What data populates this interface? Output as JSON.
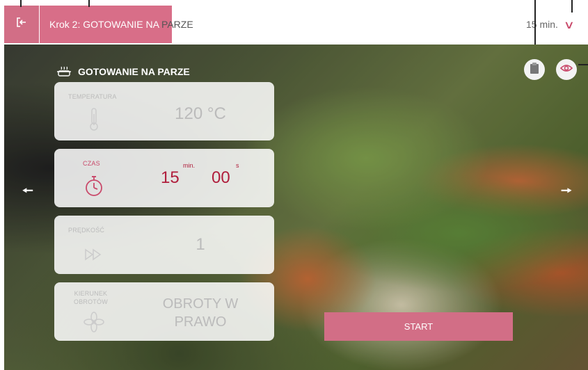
{
  "topbar": {
    "step_title_highlight": "Krok 2: GOTOWANIE NA",
    "step_title_rest": " PARZE",
    "duration_label": "15 min.",
    "exit_icon": "exit-icon",
    "chevron_icon": "chevron-down-icon"
  },
  "program": {
    "title": "GOTOWANIE NA PARZE",
    "icon": "steam-pot-icon"
  },
  "parameters": {
    "temperature": {
      "label": "TEMPERATURA",
      "value": "120 °C",
      "icon": "thermometer-icon"
    },
    "time": {
      "label": "CZAS",
      "minutes": "15",
      "minutes_unit": "min.",
      "seconds": "00",
      "seconds_unit": "s",
      "icon": "stopwatch-icon"
    },
    "speed": {
      "label": "PRĘDKOŚĆ",
      "value": "1",
      "icon": "fast-forward-icon"
    },
    "direction": {
      "label_line1": "KIERUNEK",
      "label_line2": "OBROTÓW",
      "value_line1": "OBROTY W",
      "value_line2": "PRAWO",
      "icon": "rotation-fan-icon"
    }
  },
  "actions": {
    "start_label": "START"
  },
  "colors": {
    "accent": "#d26e86",
    "time_red": "#b01e3c"
  }
}
